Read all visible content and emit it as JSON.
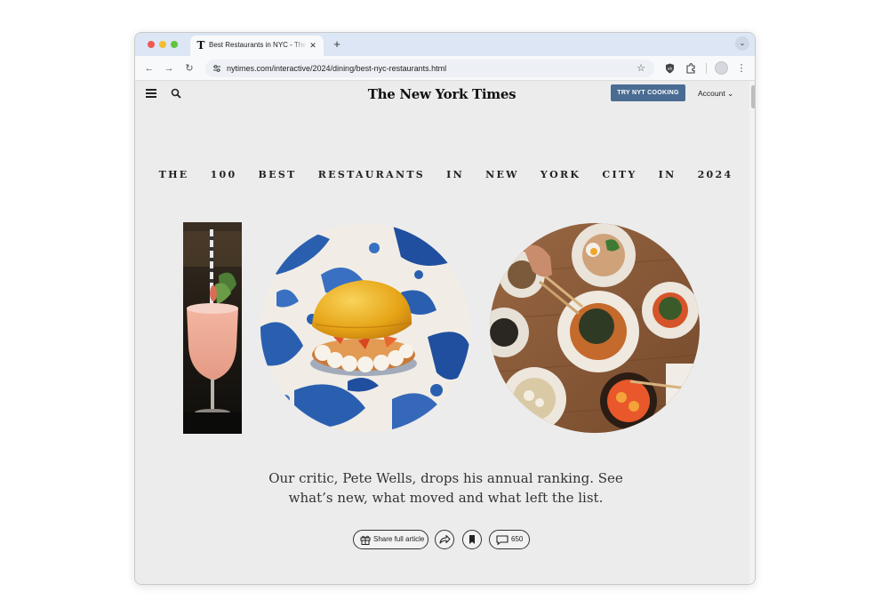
{
  "browser": {
    "tab_title": "Best Restaurants in NYC - The New York Times",
    "tab_favicon": "T",
    "tab_close": "✕",
    "new_tab": "+",
    "tab_menu": "⌄",
    "url": "nytimes.com/interactive/2024/dining/best-nyc-restaurants.html",
    "back": "←",
    "forward": "→",
    "reload": "↻",
    "star": "☆",
    "menu": "⋮"
  },
  "header": {
    "logo": "The New York Times",
    "cta_label": "TRY NYT COOKING",
    "account_label": "Account ⌄"
  },
  "article": {
    "headline": "THE 100 BEST RESTAURANTS IN NEW YORK CITY IN 2024",
    "dek_line1": "Our critic, Pete Wells, drops his annual ranking. See",
    "dek_line2": "what’s new, what moved and what left the list.",
    "share_label": "Share full article",
    "comments_count": "650"
  },
  "colors": {
    "page_bg": "#ececec",
    "cta_bg": "#4a6c92",
    "plate_blue": "#2a5fb0",
    "table_wood": "#8a5a36"
  }
}
